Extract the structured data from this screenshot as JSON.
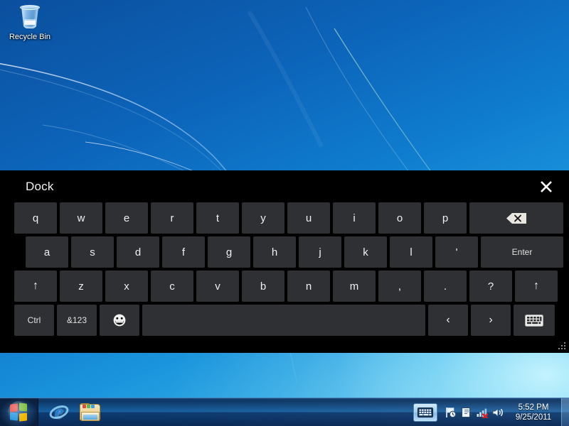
{
  "desktop": {
    "icons": [
      {
        "name": "recycle-bin",
        "label": "Recycle Bin"
      }
    ],
    "wallpaper": {
      "name": "windows-7-harmony",
      "top_color": "#0b4f9e",
      "bottom_color": "#66cdef"
    }
  },
  "dock": {
    "title": "Dock",
    "close_label": "✕",
    "background": "#000000",
    "key_color": "#2f3033",
    "key_text_color": "#f0f0f0",
    "keyboard": {
      "rows": [
        {
          "id": "row-top",
          "keys": [
            {
              "label": "q",
              "name": "key-q",
              "type": "char"
            },
            {
              "label": "w",
              "name": "key-w",
              "type": "char"
            },
            {
              "label": "e",
              "name": "key-e",
              "type": "char"
            },
            {
              "label": "r",
              "name": "key-r",
              "type": "char"
            },
            {
              "label": "t",
              "name": "key-t",
              "type": "char"
            },
            {
              "label": "y",
              "name": "key-y",
              "type": "char"
            },
            {
              "label": "u",
              "name": "key-u",
              "type": "char"
            },
            {
              "label": "i",
              "name": "key-i",
              "type": "char"
            },
            {
              "label": "o",
              "name": "key-o",
              "type": "char"
            },
            {
              "label": "p",
              "name": "key-p",
              "type": "char"
            },
            {
              "label": "",
              "name": "key-backspace",
              "type": "backspace",
              "icon": "backspace-icon"
            }
          ]
        },
        {
          "id": "row-home",
          "keys": [
            {
              "label": "a",
              "name": "key-a",
              "type": "char"
            },
            {
              "label": "s",
              "name": "key-s",
              "type": "char"
            },
            {
              "label": "d",
              "name": "key-d",
              "type": "char"
            },
            {
              "label": "f",
              "name": "key-f",
              "type": "char"
            },
            {
              "label": "g",
              "name": "key-g",
              "type": "char"
            },
            {
              "label": "h",
              "name": "key-h",
              "type": "char"
            },
            {
              "label": "j",
              "name": "key-j",
              "type": "char"
            },
            {
              "label": "k",
              "name": "key-k",
              "type": "char"
            },
            {
              "label": "l",
              "name": "key-l",
              "type": "char"
            },
            {
              "label": "'",
              "name": "key-apostrophe",
              "type": "char"
            },
            {
              "label": "Enter",
              "name": "key-enter",
              "type": "enter"
            }
          ]
        },
        {
          "id": "row-bottom",
          "keys": [
            {
              "label": "↑",
              "name": "key-shift-left",
              "type": "shift"
            },
            {
              "label": "z",
              "name": "key-z",
              "type": "char"
            },
            {
              "label": "x",
              "name": "key-x",
              "type": "char"
            },
            {
              "label": "c",
              "name": "key-c",
              "type": "char"
            },
            {
              "label": "v",
              "name": "key-v",
              "type": "char"
            },
            {
              "label": "b",
              "name": "key-b",
              "type": "char"
            },
            {
              "label": "n",
              "name": "key-n",
              "type": "char"
            },
            {
              "label": "m",
              "name": "key-m",
              "type": "char"
            },
            {
              "label": ",",
              "name": "key-comma",
              "type": "char"
            },
            {
              "label": ".",
              "name": "key-period",
              "type": "char"
            },
            {
              "label": "?",
              "name": "key-question",
              "type": "char"
            },
            {
              "label": "↑",
              "name": "key-shift-right",
              "type": "shift"
            }
          ]
        },
        {
          "id": "row-space",
          "keys": [
            {
              "label": "Ctrl",
              "name": "key-ctrl",
              "type": "mod"
            },
            {
              "label": "&123",
              "name": "key-symbols",
              "type": "mod"
            },
            {
              "label": "",
              "name": "key-emoji",
              "type": "emoji",
              "icon": "smiley-icon"
            },
            {
              "label": "",
              "name": "key-space",
              "type": "space"
            },
            {
              "label": "‹",
              "name": "key-arrow-left",
              "type": "nav"
            },
            {
              "label": "›",
              "name": "key-arrow-right",
              "type": "nav"
            },
            {
              "label": "",
              "name": "key-keyboard-layout",
              "type": "kbicon",
              "icon": "keyboard-icon"
            }
          ]
        }
      ]
    }
  },
  "taskbar": {
    "start_label": "Start",
    "quicklaunch": [
      {
        "name": "taskbar-internet-explorer",
        "label": "Internet Explorer",
        "icon": "internet-explorer-icon"
      },
      {
        "name": "taskbar-windows-explorer",
        "label": "Windows Explorer",
        "icon": "folder-icon"
      }
    ],
    "tray": {
      "keyboard_button": {
        "name": "tray-keyboard-button",
        "icon": "keyboard-icon"
      },
      "icons": [
        {
          "name": "tray-action-center",
          "icon": "flag-clock-icon"
        },
        {
          "name": "tray-device",
          "icon": "plug-icon"
        },
        {
          "name": "tray-network",
          "icon": "network-disconnected-icon"
        },
        {
          "name": "tray-volume",
          "icon": "speaker-icon"
        }
      ],
      "clock": {
        "time": "5:52 PM",
        "date": "9/25/2011"
      }
    }
  }
}
